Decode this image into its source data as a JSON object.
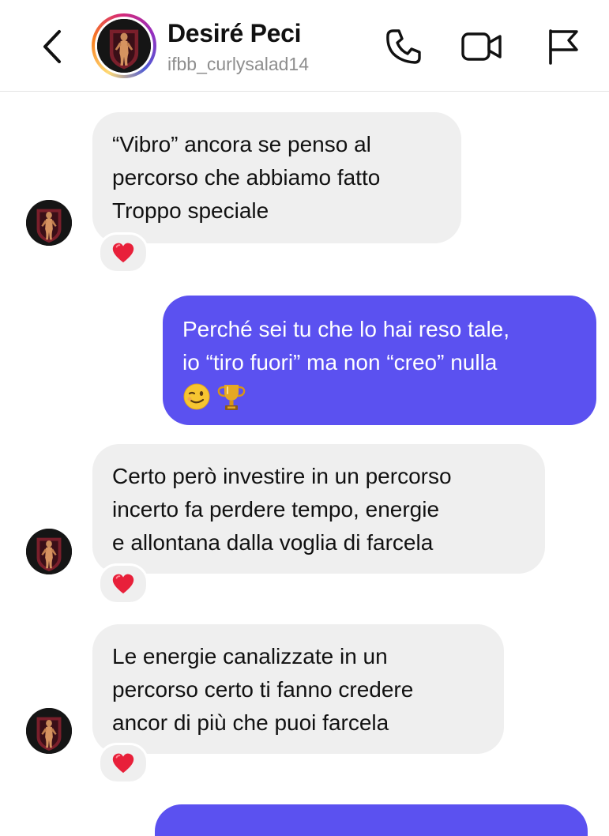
{
  "header": {
    "name": "Desiré Peci",
    "username": "ifbb_curlysalad14"
  },
  "colors": {
    "outgoing_bubble": "#5b51f0",
    "incoming_bubble": "#efefef",
    "username_gray": "#8e8e8e",
    "reaction_heart": "#e8203a"
  },
  "icons": {
    "back": "chevron-left-icon",
    "call": "phone-icon",
    "video": "video-camera-icon",
    "report": "flag-icon",
    "reaction": "red-heart-emoji",
    "emoji_1": "winking-face-emoji",
    "emoji_2": "trophy-emoji"
  },
  "messages": [
    {
      "sender": "incoming",
      "lines": [
        "“Vibro” ancora se penso al",
        "percorso che abbiamo fatto",
        "Troppo speciale"
      ],
      "reaction": "heart"
    },
    {
      "sender": "outgoing",
      "lines": [
        "Perché sei tu che lo hai reso tale,",
        "io “tiro fuori” ma non “creo” nulla"
      ],
      "emojis": [
        "wink",
        "trophy"
      ]
    },
    {
      "sender": "incoming",
      "lines": [
        "Certo però investire in un percorso",
        "incerto fa perdere tempo, energie",
        "e allontana dalla voglia di farcela"
      ],
      "reaction": "heart"
    },
    {
      "sender": "incoming",
      "lines": [
        "Le energie canalizzate in un",
        "percorso certo ti fanno credere",
        "ancor di più che puoi farcela"
      ],
      "reaction": "heart"
    }
  ]
}
